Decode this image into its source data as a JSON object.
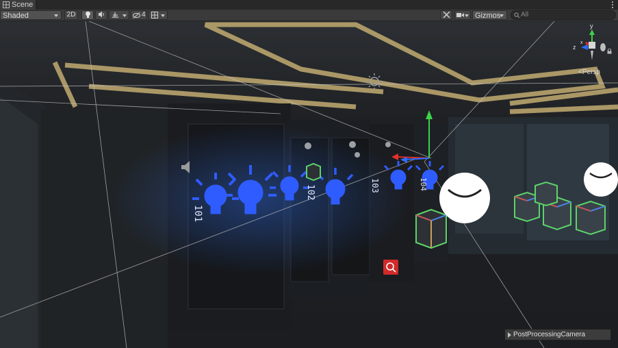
{
  "tab": {
    "title": "Scene"
  },
  "toolbar": {
    "shading_mode": "Shaded",
    "mode_2d": "2D",
    "hidden_count": "4",
    "gizmos": "Gizmos",
    "search_placeholder": "All"
  },
  "orientation_gizmo": {
    "axis_y": "y",
    "axis_z": "z",
    "axis_x": "x",
    "projection": "Persp"
  },
  "scene_labels": {
    "rack_101": "101",
    "rack_102": "102",
    "rack_103": "103",
    "rack_104": "104"
  },
  "overlay": {
    "camera_label": "PostProcessingCamera"
  },
  "colors": {
    "light_icon": "#2f5cff",
    "gizmo_y": "#3cd34a",
    "gizmo_x": "#e0302a",
    "gizmo_z": "#2e6cff",
    "ceiling_light": "#cbb57a"
  }
}
